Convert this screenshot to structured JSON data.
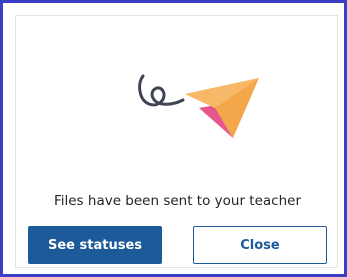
{
  "dialog": {
    "illustration": "paper-plane-sent-icon",
    "message": "Files have been sent to your teacher",
    "primary_button_label": "See statuses",
    "secondary_button_label": "Close"
  },
  "colors": {
    "frame_border": "#3b3fc4",
    "primary_button": "#1c5a9a",
    "plane_orange": "#f4a64a",
    "plane_pink": "#e5568e",
    "swirl": "#3d4452"
  }
}
